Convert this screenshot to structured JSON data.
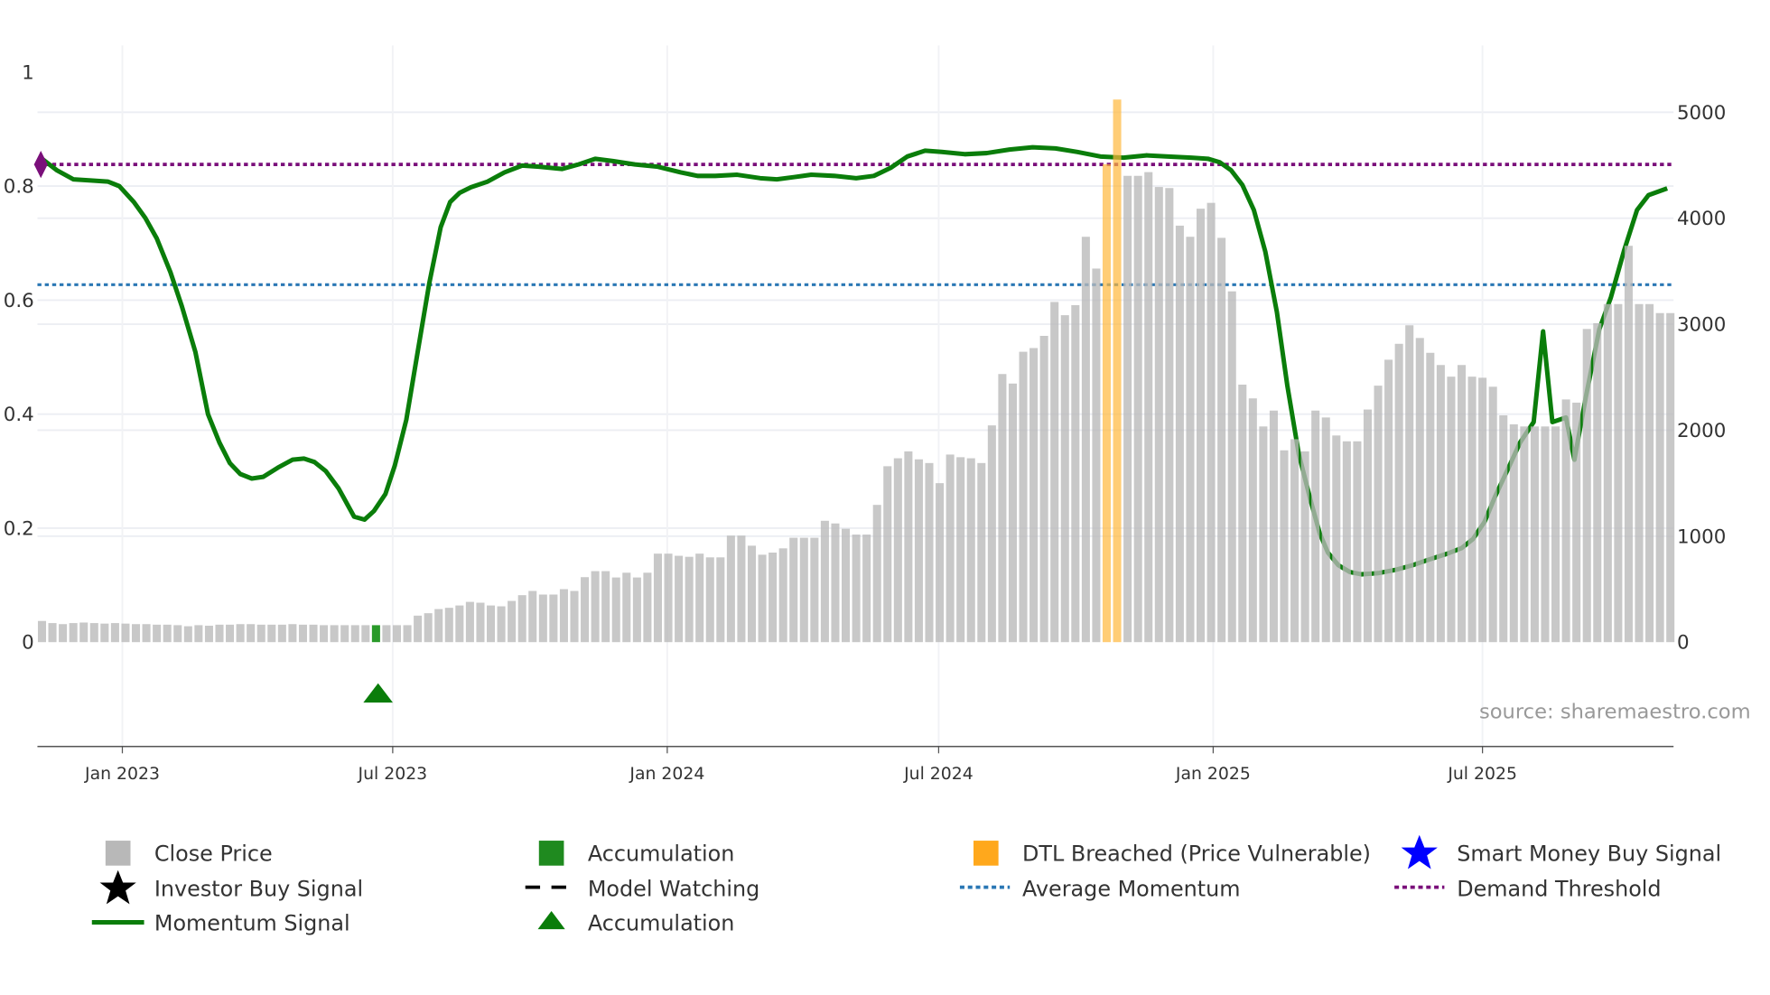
{
  "chart_data": {
    "type": "bar+line",
    "title": "",
    "x_unit": "weeks since first bar",
    "x_ticks": [
      {
        "label": "Jan 2023",
        "pos": 7.7
      },
      {
        "label": "Jul 2023",
        "pos": 33.6
      },
      {
        "label": "Jan 2024",
        "pos": 59.9
      },
      {
        "label": "Jul 2024",
        "pos": 85.9
      },
      {
        "label": "Jan 2025",
        "pos": 112.2
      },
      {
        "label": "Jul 2025",
        "pos": 138.0
      }
    ],
    "y_left": {
      "ticks": [
        0,
        0.2,
        0.4,
        0.6,
        0.8,
        1
      ],
      "labels": [
        "0",
        "0.2",
        "0.4",
        "0.6",
        "0.8",
        "1"
      ],
      "range": [
        -0.183,
        1.05
      ]
    },
    "y_right": {
      "ticks": [
        0,
        1000,
        2000,
        3000,
        4000,
        5000
      ],
      "labels": [
        "0",
        "1000",
        "2000",
        "3000",
        "4000",
        "5000"
      ]
    },
    "close_price": [
      200,
      180,
      170,
      180,
      185,
      180,
      175,
      180,
      175,
      170,
      170,
      165,
      165,
      160,
      150,
      160,
      155,
      165,
      165,
      170,
      170,
      165,
      165,
      165,
      170,
      165,
      165,
      160,
      160,
      160,
      160,
      160,
      160,
      160,
      160,
      160,
      250,
      273,
      312,
      324,
      346,
      380,
      372,
      346,
      338,
      389,
      443,
      483,
      449,
      449,
      500,
      483,
      613,
      670,
      670,
      610,
      655,
      610,
      655,
      835,
      835,
      815,
      805,
      835,
      800,
      800,
      1005,
      1005,
      910,
      825,
      845,
      885,
      985,
      985,
      985,
      1145,
      1120,
      1070,
      1015,
      1015,
      1295,
      1660,
      1735,
      1800,
      1725,
      1690,
      1500,
      1770,
      1745,
      1735,
      1690,
      2045,
      2530,
      2440,
      2740,
      2775,
      2890,
      3210,
      3085,
      3180,
      3825,
      3525,
      4510,
      5120,
      4400,
      4400,
      4435,
      4295,
      4285,
      3930,
      3825,
      4090,
      4145,
      3815,
      3310,
      2430,
      2300,
      2035,
      2185,
      1810,
      1915,
      1800,
      2185,
      2120,
      1950,
      1895,
      1895,
      2195,
      2420,
      2665,
      2815,
      2990,
      2870,
      2730,
      2615,
      2505,
      2615,
      2505,
      2495,
      2410,
      2140,
      2055,
      2035,
      2035,
      2035,
      2035,
      2290,
      2260,
      2955,
      3010,
      3190,
      3190,
      3740,
      3190,
      3190,
      3105,
      3105
    ],
    "accumulation_bars": [
      32
    ],
    "dtl_breached_bars": [
      102,
      103
    ],
    "momentum": [
      [
        0,
        0.848
      ],
      [
        1.4,
        0.828
      ],
      [
        3.0,
        0.812
      ],
      [
        4.7,
        0.81
      ],
      [
        6.3,
        0.808
      ],
      [
        7.4,
        0.8
      ],
      [
        8.8,
        0.772
      ],
      [
        9.9,
        0.744
      ],
      [
        11.0,
        0.708
      ],
      [
        12.3,
        0.649
      ],
      [
        13.4,
        0.589
      ],
      [
        14.7,
        0.509
      ],
      [
        15.9,
        0.4
      ],
      [
        17.0,
        0.35
      ],
      [
        18.0,
        0.314
      ],
      [
        19.0,
        0.295
      ],
      [
        20.1,
        0.287
      ],
      [
        21.2,
        0.29
      ],
      [
        22.6,
        0.306
      ],
      [
        24.0,
        0.32
      ],
      [
        25.1,
        0.322
      ],
      [
        26.1,
        0.316
      ],
      [
        27.2,
        0.3
      ],
      [
        28.4,
        0.27
      ],
      [
        29.9,
        0.22
      ],
      [
        30.9,
        0.215
      ],
      [
        31.8,
        0.23
      ],
      [
        32.9,
        0.26
      ],
      [
        33.8,
        0.31
      ],
      [
        34.9,
        0.39
      ],
      [
        36.0,
        0.51
      ],
      [
        37.1,
        0.629
      ],
      [
        38.2,
        0.728
      ],
      [
        39.1,
        0.772
      ],
      [
        40.0,
        0.788
      ],
      [
        41.1,
        0.798
      ],
      [
        42.7,
        0.808
      ],
      [
        44.3,
        0.824
      ],
      [
        46.0,
        0.836
      ],
      [
        47.6,
        0.834
      ],
      [
        49.8,
        0.83
      ],
      [
        51.4,
        0.838
      ],
      [
        53.0,
        0.848
      ],
      [
        54.7,
        0.844
      ],
      [
        56.8,
        0.838
      ],
      [
        59.0,
        0.834
      ],
      [
        61.2,
        0.824
      ],
      [
        62.8,
        0.818
      ],
      [
        64.5,
        0.818
      ],
      [
        66.6,
        0.82
      ],
      [
        68.8,
        0.814
      ],
      [
        70.4,
        0.812
      ],
      [
        72.1,
        0.816
      ],
      [
        73.7,
        0.82
      ],
      [
        75.9,
        0.818
      ],
      [
        78.0,
        0.814
      ],
      [
        79.7,
        0.818
      ],
      [
        81.3,
        0.832
      ],
      [
        82.9,
        0.852
      ],
      [
        84.6,
        0.862
      ],
      [
        86.2,
        0.86
      ],
      [
        88.4,
        0.856
      ],
      [
        90.5,
        0.858
      ],
      [
        92.7,
        0.864
      ],
      [
        94.9,
        0.868
      ],
      [
        97.1,
        0.866
      ],
      [
        99.2,
        0.86
      ],
      [
        101.4,
        0.852
      ],
      [
        103.6,
        0.85
      ],
      [
        105.8,
        0.854
      ],
      [
        107.9,
        0.852
      ],
      [
        110.1,
        0.85
      ],
      [
        111.7,
        0.848
      ],
      [
        112.8,
        0.842
      ],
      [
        113.9,
        0.828
      ],
      [
        115.0,
        0.802
      ],
      [
        116.1,
        0.758
      ],
      [
        117.2,
        0.685
      ],
      [
        118.3,
        0.579
      ],
      [
        119.3,
        0.45
      ],
      [
        120.4,
        0.33
      ],
      [
        121.5,
        0.251
      ],
      [
        122.4,
        0.191
      ],
      [
        123.2,
        0.157
      ],
      [
        124.2,
        0.135
      ],
      [
        125.3,
        0.123
      ],
      [
        126.4,
        0.119
      ],
      [
        128.0,
        0.121
      ],
      [
        129.7,
        0.127
      ],
      [
        131.3,
        0.135
      ],
      [
        132.9,
        0.145
      ],
      [
        134.6,
        0.155
      ],
      [
        136.0,
        0.165
      ],
      [
        137.1,
        0.181
      ],
      [
        138.2,
        0.211
      ],
      [
        139.2,
        0.255
      ],
      [
        140.5,
        0.306
      ],
      [
        141.6,
        0.35
      ],
      [
        142.9,
        0.386
      ],
      [
        143.8,
        0.545
      ],
      [
        144.7,
        0.386
      ],
      [
        146.0,
        0.394
      ],
      [
        146.8,
        0.32
      ],
      [
        147.9,
        0.43
      ],
      [
        149.2,
        0.549
      ],
      [
        150.3,
        0.605
      ],
      [
        151.6,
        0.689
      ],
      [
        152.8,
        0.758
      ],
      [
        153.9,
        0.784
      ],
      [
        155.7,
        0.796
      ]
    ],
    "average_momentum": 0.627,
    "demand_threshold": 0.838,
    "demand_marker": {
      "pos": 0,
      "value": 0.838
    },
    "accumulation_markers": [
      {
        "pos": 32.2,
        "value": -0.09
      }
    ],
    "legend_placement": "bottom",
    "legend": [
      {
        "label": "Close Price",
        "symbol": "square",
        "color": "#b8b8b8"
      },
      {
        "label": "Accumulation",
        "symbol": "square",
        "color": "#1f8a1f"
      },
      {
        "label": "DTL Breached (Price Vulnerable)",
        "symbol": "square",
        "color": "#ffa81c"
      },
      {
        "label": "Smart Money Buy Signal",
        "symbol": "star",
        "color": "#0000ff"
      },
      {
        "label": "Investor Buy Signal",
        "symbol": "star",
        "color": "#000000"
      },
      {
        "label": "Model Watching",
        "symbol": "dash",
        "color": "#000000"
      },
      {
        "label": "Average Momentum",
        "symbol": "dot",
        "color": "#2a77b4"
      },
      {
        "label": "Demand Threshold",
        "symbol": "dot",
        "color": "#7a0f7a"
      },
      {
        "label": "Momentum Signal",
        "symbol": "line",
        "color": "#0a7d0a"
      },
      {
        "label": "Accumulation",
        "symbol": "triangle",
        "color": "#0a7d0a"
      }
    ],
    "source": "source: sharemaestro.com"
  },
  "colors": {
    "price": "#bdbdbd",
    "momentum": "#0a7d0a",
    "accum": "#2a9a2a",
    "dtl": "#ffc766",
    "avg": "#2a77b4",
    "demand": "#7a0f7a",
    "grid": "#eceef3"
  }
}
